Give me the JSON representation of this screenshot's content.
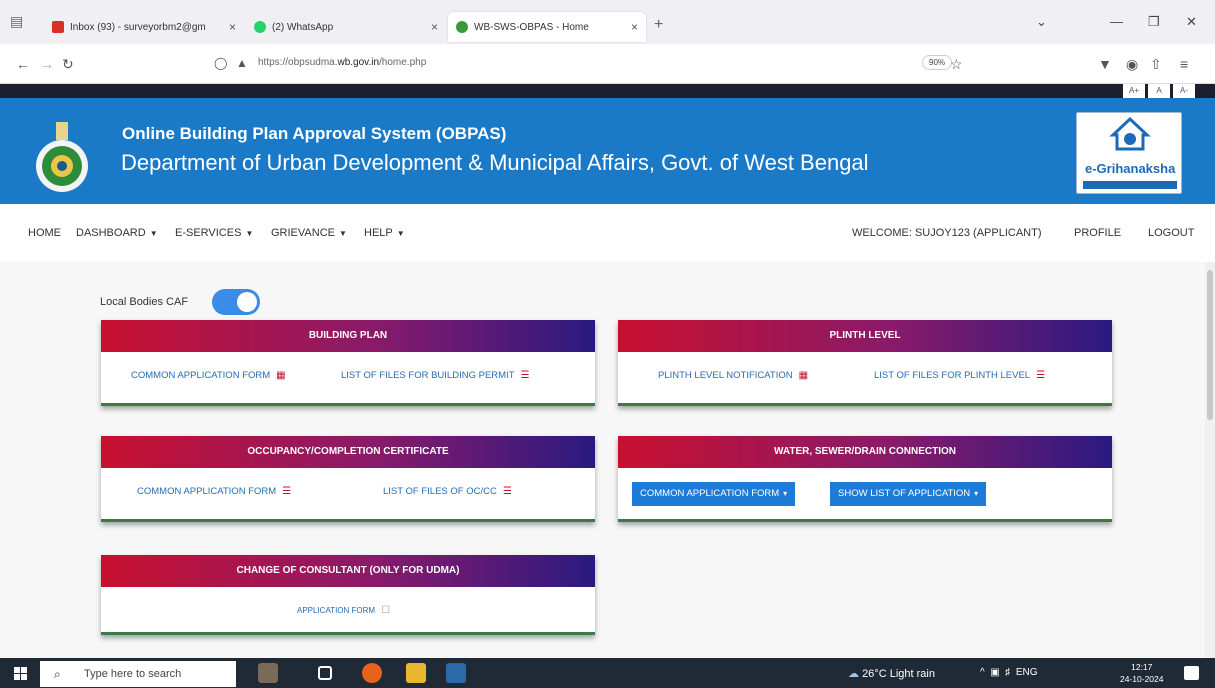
{
  "browser": {
    "tabs": [
      {
        "title": "Inbox (93) - surveyorbm2@gm",
        "favicon_color": "#d93025"
      },
      {
        "title": "(2) WhatsApp",
        "favicon_color": "#25d366"
      },
      {
        "title": "WB-SWS-OBPAS - Home",
        "favicon_color": "#3a9a3a"
      }
    ],
    "url_prefix": "https://obpsudma.",
    "url_domain": "wb.gov.in",
    "url_path": "/home.php",
    "zoom": "90%"
  },
  "banner": {
    "title": "Online Building Plan Approval System (OBPAS)",
    "subtitle": "Department of Urban Development & Municipal Affairs, Govt. of West Bengal",
    "logo_text": "e-Grihanaksha"
  },
  "font_controls": [
    "A+",
    "A",
    "A-"
  ],
  "menu": {
    "home": "HOME",
    "dashboard": "DASHBOARD",
    "eservices": "E-SERVICES",
    "grievance": "GRIEVANCE",
    "help": "HELP",
    "welcome": "WELCOME: SUJOY123 (APPLICANT)",
    "profile": "PROFILE",
    "logout": "LOGOUT"
  },
  "toggle": {
    "label": "Local Bodies CAF",
    "on": true
  },
  "cards": {
    "building_plan": {
      "title": "BUILDING PLAN",
      "link1": "COMMON APPLICATION FORM",
      "link2": "LIST OF FILES FOR BUILDING PERMIT"
    },
    "plinth": {
      "title": "PLINTH LEVEL",
      "link1": "PLINTH LEVEL NOTIFICATION",
      "link2": "LIST OF FILES FOR PLINTH LEVEL"
    },
    "occupancy": {
      "title": "OCCUPANCY/COMPLETION CERTIFICATE",
      "link1": "COMMON APPLICATION FORM",
      "link2": "LIST OF FILES OF OC/CC"
    },
    "water": {
      "title": "WATER, SEWER/DRAIN CONNECTION",
      "btn1": "COMMON APPLICATION FORM",
      "btn2": "SHOW LIST OF APPLICATION"
    },
    "consultant": {
      "title": "CHANGE OF CONSULTANT (ONLY FOR UDMA)",
      "link1": "APPLICATION FORM"
    }
  },
  "taskbar": {
    "search_placeholder": "Type here to search",
    "weather": "26°C  Light rain",
    "lang": "ENG",
    "time": "12:17",
    "date": "24-10-2024"
  },
  "colors": {
    "banner": "#1a7ac8",
    "header_start": "#c8102e",
    "header_end": "#2a1a80",
    "button": "#1e7bd8"
  }
}
